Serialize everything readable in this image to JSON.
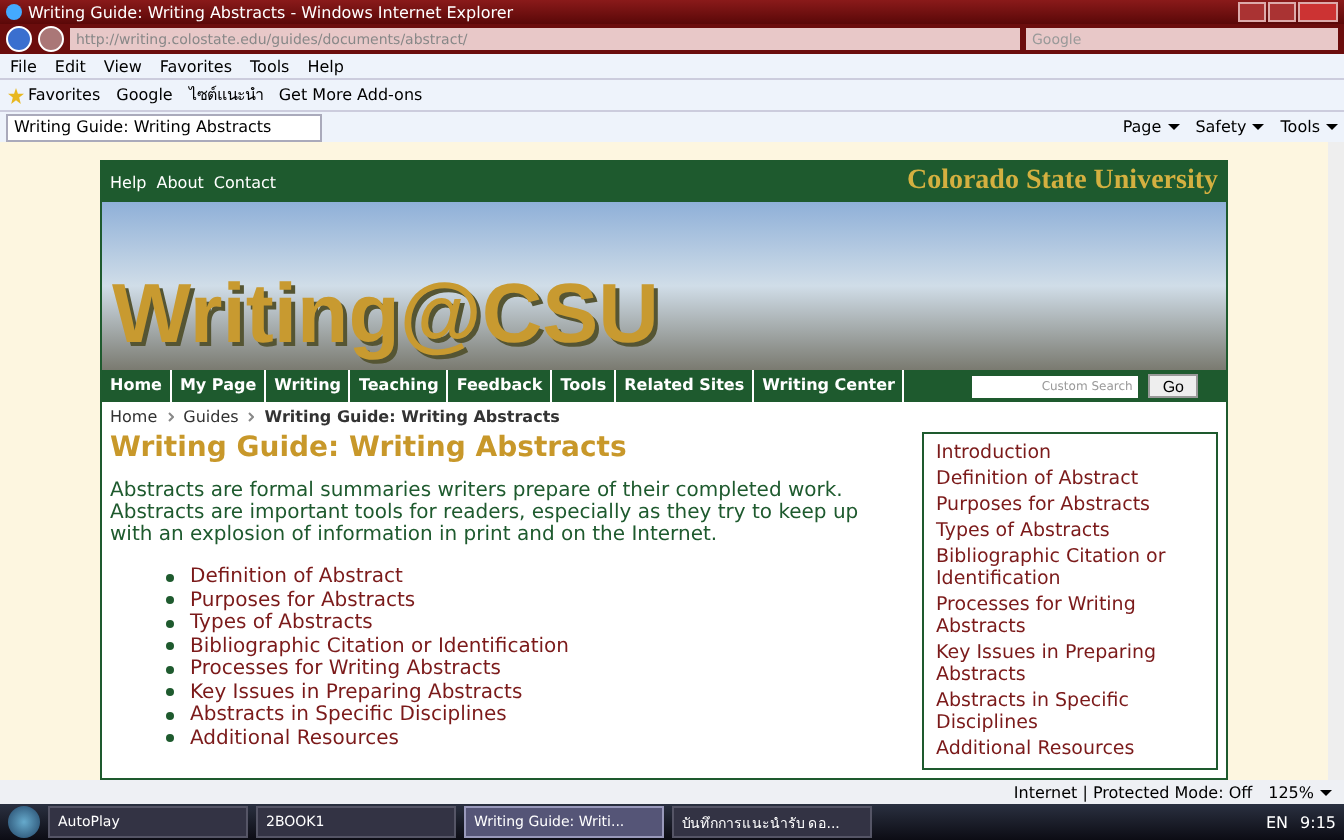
{
  "window": {
    "title": "Writing Guide: Writing Abstracts - Windows Internet Explorer"
  },
  "address_bar": {
    "url": "http://writing.colostate.edu/guides/documents/abstract/"
  },
  "search_box": {
    "placeholder": "Google"
  },
  "menu": [
    "File",
    "Edit",
    "View",
    "Favorites",
    "Tools",
    "Help"
  ],
  "favorites_bar": {
    "label": "Favorites",
    "links": [
      "Google",
      "ไซต์แนะนำ",
      "Get More Add-ons"
    ]
  },
  "tab": {
    "title": "Writing Guide: Writing Abstracts"
  },
  "command_bar": [
    "Page",
    "Safety",
    "Tools"
  ],
  "site": {
    "top_links": [
      "Help",
      "About",
      "Contact"
    ],
    "university": "Colorado State University",
    "banner_title": "Writing@CSU",
    "nav": [
      "Home",
      "My Page",
      "Writing",
      "Teaching",
      "Feedback",
      "Tools",
      "Related Sites",
      "Writing Center"
    ],
    "search_placeholder": "Custom Search",
    "search_button": "Go"
  },
  "breadcrumb": [
    "Home",
    "Guides",
    "Writing Guide: Writing Abstracts"
  ],
  "heading": "Writing Guide: Writing Abstracts",
  "intro": "Abstracts are formal summaries writers prepare of their completed work. Abstracts are important tools for readers, especially as they try to keep up with an explosion of information in print and on the Internet.",
  "topics": [
    "Definition of Abstract",
    "Purposes for Abstracts",
    "Types of Abstracts",
    "Bibliographic Citation or Identification",
    "Processes for Writing Abstracts",
    "Key Issues in Preparing Abstracts",
    "Abstracts in Specific Disciplines",
    "Additional Resources"
  ],
  "sidebar": [
    "Introduction",
    "Definition of Abstract",
    "Purposes for Abstracts",
    "Types of Abstracts",
    "Bibliographic Citation or Identification",
    "Processes for Writing Abstracts",
    "Key Issues in Preparing Abstracts",
    "Abstracts in Specific Disciplines",
    "Additional Resources"
  ],
  "status_bar": {
    "zone": "Internet | Protected Mode: Off",
    "zoom": "125%"
  },
  "taskbar": {
    "tasks": [
      {
        "label": "AutoPlay",
        "selected": false
      },
      {
        "label": "2BOOK1",
        "selected": false
      },
      {
        "label": "Writing Guide: Writi...",
        "selected": true
      },
      {
        "label": "บันทึกการแนะนำรับ ดอ...",
        "selected": false
      }
    ],
    "language": "EN",
    "time": "9:15"
  }
}
